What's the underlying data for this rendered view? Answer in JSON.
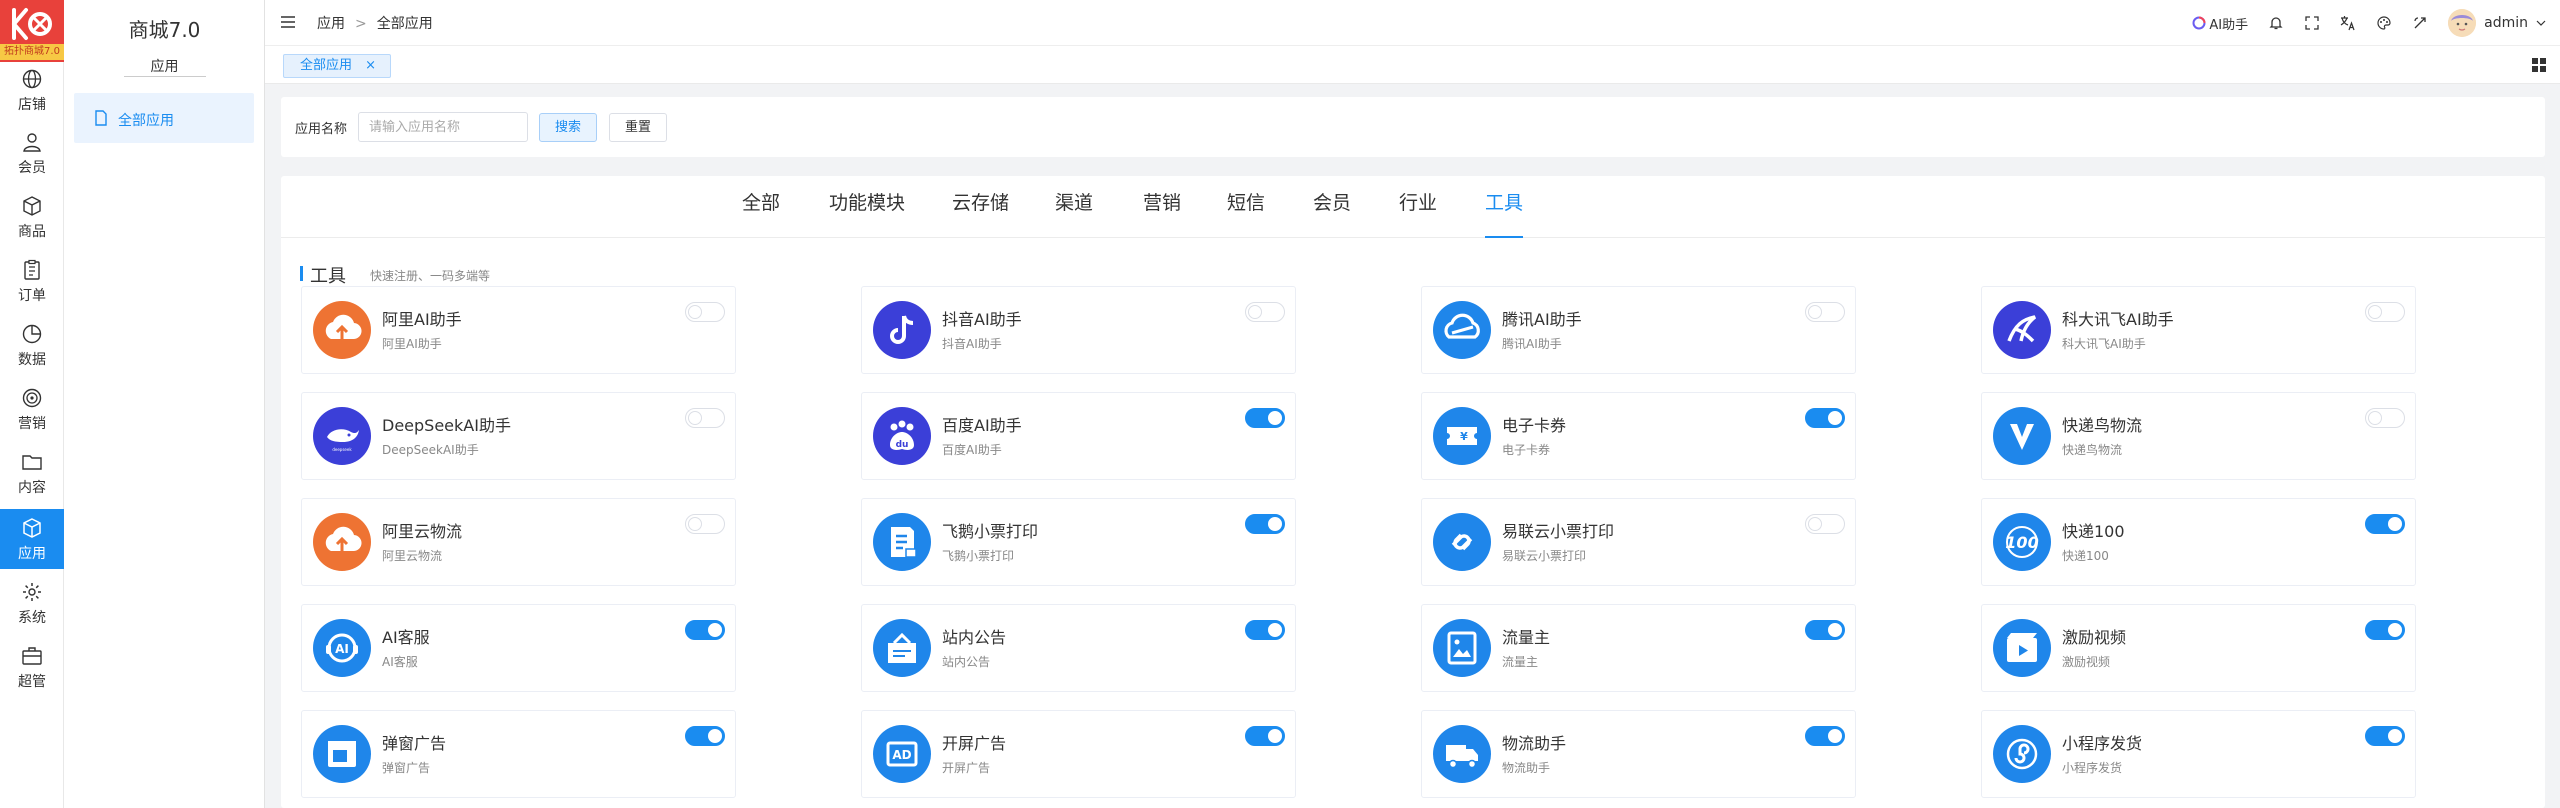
{
  "rail": {
    "logo_badge": "拓扑商城7.0",
    "items": [
      {
        "label": "店铺",
        "icon": "globe-icon"
      },
      {
        "label": "会员",
        "icon": "user-icon"
      },
      {
        "label": "商品",
        "icon": "box-icon"
      },
      {
        "label": "订单",
        "icon": "clipboard-icon"
      },
      {
        "label": "数据",
        "icon": "pie-chart-icon"
      },
      {
        "label": "营销",
        "icon": "target-icon"
      },
      {
        "label": "内容",
        "icon": "folder-icon"
      },
      {
        "label": "应用",
        "icon": "cube-icon",
        "active": true
      },
      {
        "label": "系统",
        "icon": "gear-icon"
      },
      {
        "label": "超管",
        "icon": "briefcase-icon"
      }
    ]
  },
  "submenu": {
    "title": "商城7.0",
    "section": "应用",
    "item": "全部应用"
  },
  "topbar": {
    "breadcrumb": [
      "应用",
      "全部应用"
    ],
    "breadcrumb_sep": ">",
    "ai_label": "AI助手",
    "username": "admin"
  },
  "tabs": {
    "open_tab": "全部应用",
    "close": "×"
  },
  "search": {
    "label": "应用名称",
    "placeholder": "请输入应用名称",
    "search_btn": "搜索",
    "reset_btn": "重置"
  },
  "categories": [
    "全部",
    "功能模块",
    "云存储",
    "渠道",
    "营销",
    "短信",
    "会员",
    "行业",
    "工具"
  ],
  "active_category": "工具",
  "section": {
    "title": "工具",
    "subtitle": "快速注册、一码多端等"
  },
  "colors": {
    "accent": "#1a8cf0",
    "orange": "#ee7333",
    "indigo": "#3b3fd8",
    "blue": "#1f86ea"
  },
  "apps": [
    {
      "name": "阿里AI助手",
      "desc": "阿里AI助手",
      "enabled": false,
      "icon": "aliyun-cloud-icon",
      "color": "#ee7333"
    },
    {
      "name": "抖音AI助手",
      "desc": "抖音AI助手",
      "enabled": false,
      "icon": "douyin-icon",
      "color": "#3b3fd8"
    },
    {
      "name": "腾讯AI助手",
      "desc": "腾讯AI助手",
      "enabled": false,
      "icon": "tencent-cloud-icon",
      "color": "#1f86ea"
    },
    {
      "name": "科大讯飞AI助手",
      "desc": "科大讯飞AI助手",
      "enabled": false,
      "icon": "iflytek-icon",
      "color": "#3b3fd8"
    },
    {
      "name": "DeepSeekAI助手",
      "desc": "DeepSeekAI助手",
      "enabled": false,
      "icon": "deepseek-whale-icon",
      "color": "#3b3fd8"
    },
    {
      "name": "百度AI助手",
      "desc": "百度AI助手",
      "enabled": true,
      "icon": "baidu-paw-icon",
      "color": "#3b3fd8"
    },
    {
      "name": "电子卡券",
      "desc": "电子卡券",
      "enabled": true,
      "icon": "coupon-icon",
      "color": "#1f86ea"
    },
    {
      "name": "快递鸟物流",
      "desc": "快递鸟物流",
      "enabled": false,
      "icon": "kdniao-icon",
      "color": "#1f86ea"
    },
    {
      "name": "阿里云物流",
      "desc": "阿里云物流",
      "enabled": false,
      "icon": "aliyun-cloud-icon",
      "color": "#ee7333"
    },
    {
      "name": "飞鹅小票打印",
      "desc": "飞鹅小票打印",
      "enabled": true,
      "icon": "receipt-icon",
      "color": "#1f86ea"
    },
    {
      "name": "易联云小票打印",
      "desc": "易联云小票打印",
      "enabled": false,
      "icon": "link-icon",
      "color": "#1f86ea"
    },
    {
      "name": "快递100",
      "desc": "快递100",
      "enabled": true,
      "icon": "kuaidi100-icon",
      "color": "#1f86ea"
    },
    {
      "name": "AI客服",
      "desc": "AI客服",
      "enabled": true,
      "icon": "ai-service-icon",
      "color": "#1f86ea"
    },
    {
      "name": "站内公告",
      "desc": "站内公告",
      "enabled": true,
      "icon": "announcement-icon",
      "color": "#1f86ea"
    },
    {
      "name": "流量主",
      "desc": "流量主",
      "enabled": true,
      "icon": "image-ad-icon",
      "color": "#1f86ea"
    },
    {
      "name": "激励视频",
      "desc": "激励视频",
      "enabled": true,
      "icon": "video-icon",
      "color": "#1f86ea"
    },
    {
      "name": "弹窗广告",
      "desc": "弹窗广告",
      "enabled": true,
      "icon": "popup-icon",
      "color": "#1f86ea"
    },
    {
      "name": "开屏广告",
      "desc": "开屏广告",
      "enabled": true,
      "icon": "ad-badge-icon",
      "color": "#1f86ea"
    },
    {
      "name": "物流助手",
      "desc": "物流助手",
      "enabled": true,
      "icon": "truck-icon",
      "color": "#1f86ea"
    },
    {
      "name": "小程序发货",
      "desc": "小程序发货",
      "enabled": true,
      "icon": "miniprogram-icon",
      "color": "#1f86ea"
    }
  ]
}
